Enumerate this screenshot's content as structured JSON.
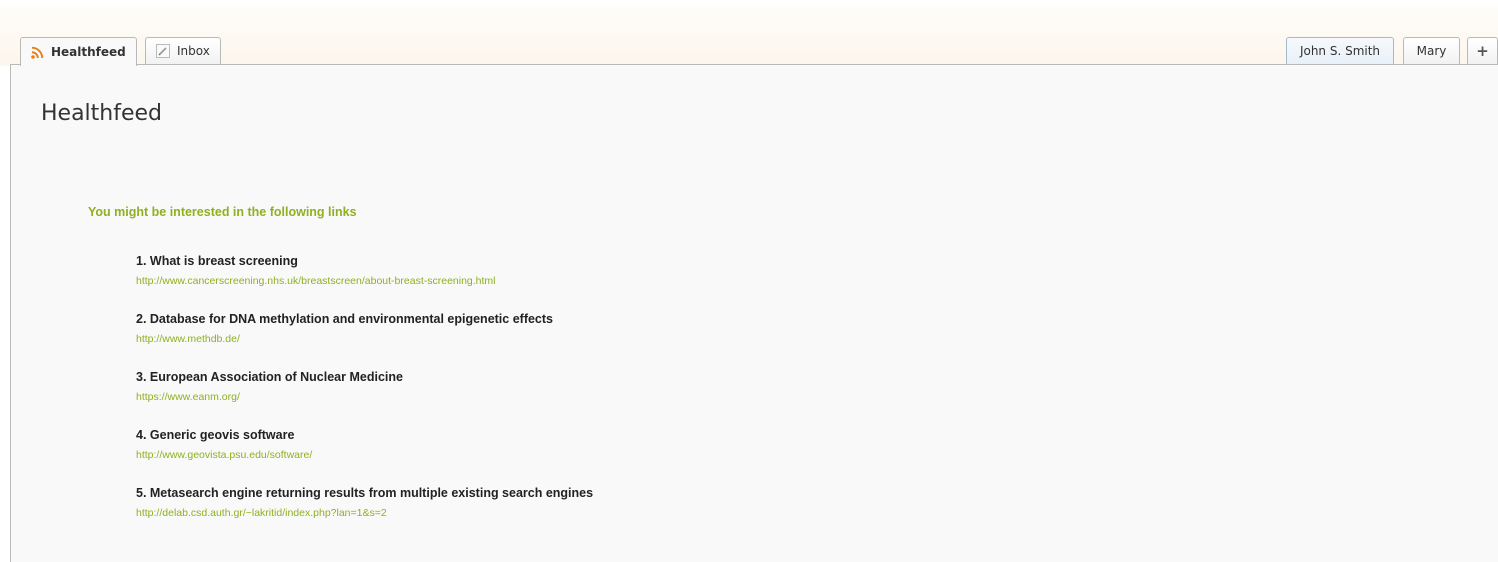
{
  "tabs": [
    {
      "label": "Healthfeed",
      "icon": "rss-icon",
      "active": true
    },
    {
      "label": "Inbox",
      "icon": "pencil-icon",
      "active": false
    }
  ],
  "people_tabs": [
    {
      "label": "John S. Smith",
      "selected": true
    },
    {
      "label": "Mary",
      "selected": false
    }
  ],
  "add_tab_label": "+",
  "page_title": "Healthfeed",
  "section_heading": "You might be interested in the following links",
  "links": [
    {
      "title": "1. What is breast screening",
      "url": "http://www.cancerscreening.nhs.uk/breastscreen/about-breast-screening.html"
    },
    {
      "title": "2. Database for DNA methylation and environmental epigenetic effects",
      "url": "http://www.methdb.de/"
    },
    {
      "title": "3. European Association of Nuclear Medicine",
      "url": "https://www.eanm.org/"
    },
    {
      "title": "4. Generic geovis software",
      "url": "http://www.geovista.psu.edu/software/"
    },
    {
      "title": "5. Metasearch engine returning results from multiple existing search engines",
      "url": "http://delab.csd.auth.gr/~lakritid/index.php?lan=1&s=2"
    }
  ],
  "colors": {
    "accent": "#8fb021",
    "rss": "#e8821e"
  }
}
